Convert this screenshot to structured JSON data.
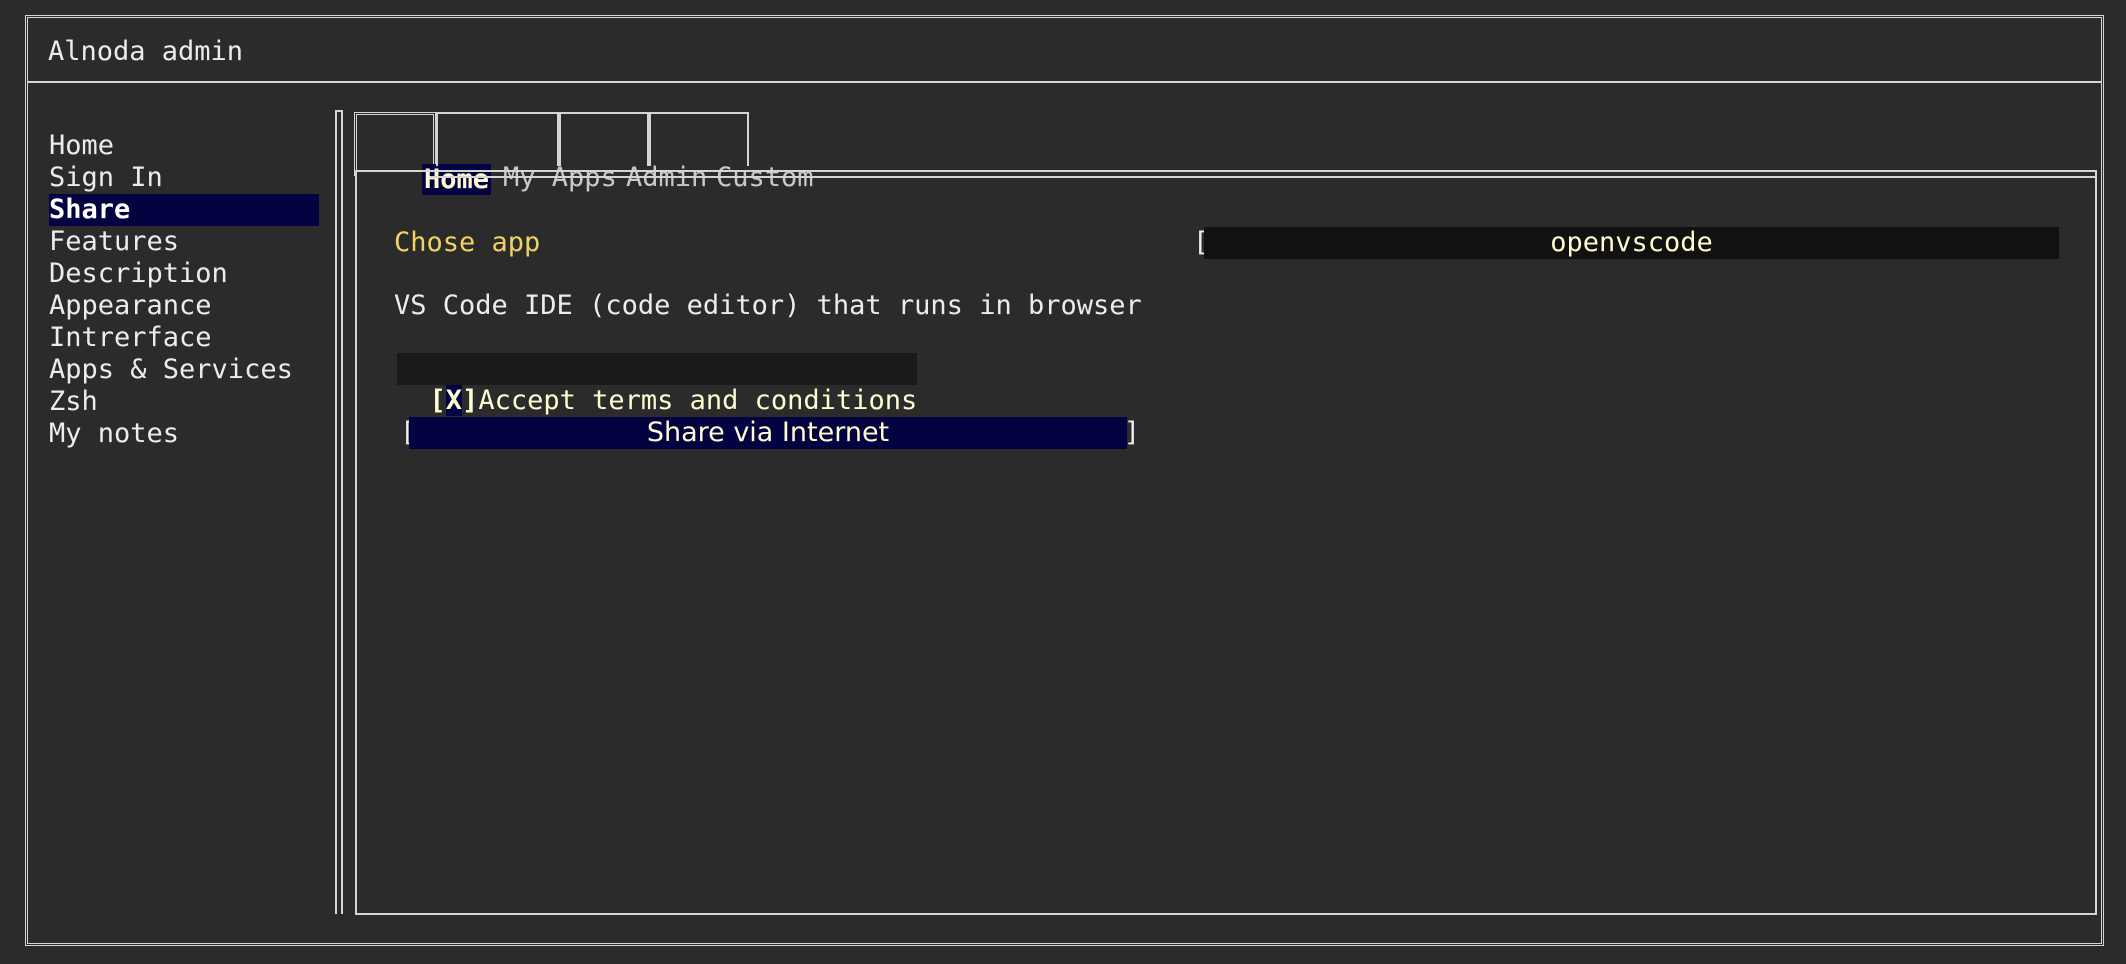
{
  "app": {
    "title": "Alnoda admin"
  },
  "sidebar": {
    "items": [
      {
        "label": "Home"
      },
      {
        "label": "Sign In"
      },
      {
        "label": "Share"
      },
      {
        "label": "Features"
      },
      {
        "label": "Description"
      },
      {
        "label": "Appearance"
      },
      {
        "label": "Intrerface"
      },
      {
        "label": "Apps & Services"
      },
      {
        "label": "Zsh"
      },
      {
        "label": "My notes"
      }
    ],
    "selected_index": 2
  },
  "tabs": [
    {
      "label": "Home",
      "active": true
    },
    {
      "label": "My Apps",
      "active": false
    },
    {
      "label": "Admin",
      "active": false
    },
    {
      "label": "Custom",
      "active": false
    }
  ],
  "main": {
    "chose_app_label": "Chose app",
    "app_select": {
      "bracket": "[",
      "value": "openvscode"
    },
    "description": "VS Code IDE (code editor) that runs in browser",
    "accept": {
      "box_open": "[",
      "box_mark": "X",
      "box_close": "]",
      "label": "Accept terms and conditions",
      "checked": true
    },
    "share_button": {
      "left": "[",
      "label": "Share via Internet",
      "right": "]"
    }
  },
  "colors": {
    "background": "#2b2b2b",
    "border": "#d4d4d4",
    "selection": "#020340",
    "highlight_text": "#fffbd0",
    "label_yellow": "#f0d264"
  }
}
